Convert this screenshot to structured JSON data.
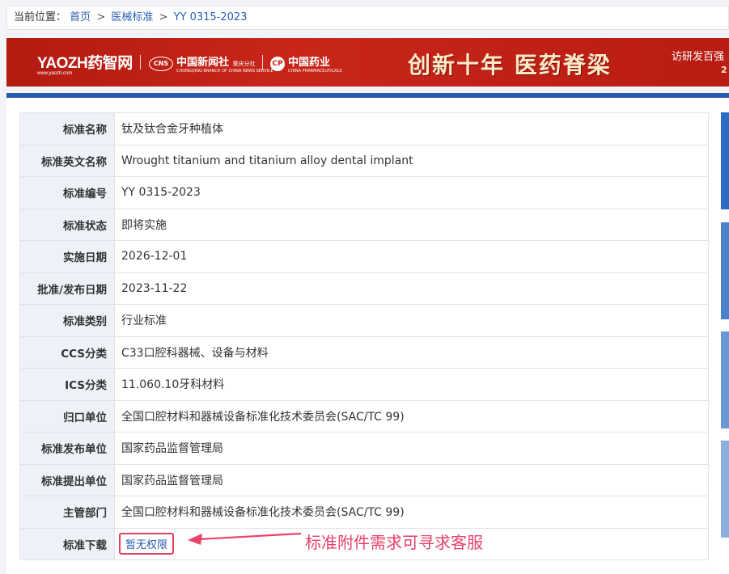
{
  "breadcrumb": {
    "prefix": "当前位置：",
    "home": "首页",
    "category": "医械标准",
    "current": "YY 0315-2023",
    "sep": ">"
  },
  "banner": {
    "logo_main": "YAOZH药智网",
    "logo_main_sub": "www.yaozh.com",
    "logo_cns_badge": "CNS",
    "logo_cns": "中国新闻社",
    "logo_cns_branch": "重庆分社",
    "logo_cns_en": "CHONGQING BRANCH OF CHINA NEWS SERVICE",
    "logo_cp_badge": "CP",
    "logo_cp": "中国药业",
    "logo_cp_en": "CHINA PHARMACEUTICALS",
    "slogan": "创新十年 医药脊梁",
    "sub": "访研发百强",
    "sub2": "2"
  },
  "rows": [
    {
      "key": "标准名称",
      "value": "钛及钛合金牙种植体"
    },
    {
      "key": "标准英文名称",
      "value": "Wrought titanium and titanium alloy dental implant"
    },
    {
      "key": "标准编号",
      "value": "YY 0315-2023"
    },
    {
      "key": "标准状态",
      "value": "即将实施"
    },
    {
      "key": "实施日期",
      "value": "2026-12-01"
    },
    {
      "key": "批准/发布日期",
      "value": "2023-11-22"
    },
    {
      "key": "标准类别",
      "value": "行业标准"
    },
    {
      "key": "CCS分类",
      "value": "C33口腔科器械、设备与材料"
    },
    {
      "key": "ICS分类",
      "value": "11.060.10牙科材料"
    },
    {
      "key": "归口单位",
      "value": "全国口腔材料和器械设备标准化技术委员会(SAC/TC 99)"
    },
    {
      "key": "标准发布单位",
      "value": "国家药品监督管理局"
    },
    {
      "key": "标准提出单位",
      "value": "国家药品监督管理局"
    },
    {
      "key": "主管部门",
      "value": "全国口腔材料和器械设备标准化技术委员会(SAC/TC 99)"
    }
  ],
  "download": {
    "key": "标准下载",
    "link": "暂无权限"
  },
  "annotation": {
    "text": "标准附件需求可寻求客服",
    "color": "#e8416a"
  },
  "colors": {
    "banner_red": "#c8261a",
    "accent_blue": "#2b5cab",
    "link_blue": "#2a5db0"
  }
}
